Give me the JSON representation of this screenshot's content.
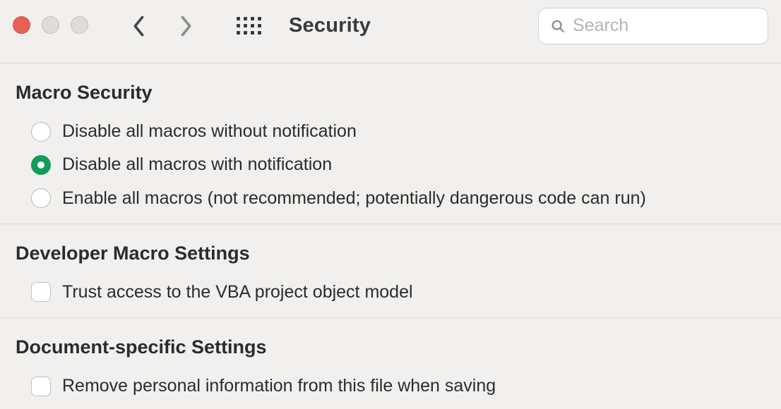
{
  "header": {
    "title": "Security",
    "search_placeholder": "Search"
  },
  "sections": {
    "macro_security": {
      "title": "Macro Security",
      "options": [
        {
          "label": "Disable all macros without notification",
          "checked": false
        },
        {
          "label": "Disable all macros with notification",
          "checked": true
        },
        {
          "label": "Enable all macros (not recommended; potentially dangerous code can run)",
          "checked": false
        }
      ]
    },
    "developer": {
      "title": "Developer Macro Settings",
      "option": {
        "label": "Trust access to the VBA project object model",
        "checked": false
      }
    },
    "document_specific": {
      "title": "Document-specific Settings",
      "option": {
        "label": "Remove personal information from this file when saving",
        "checked": false
      }
    }
  }
}
